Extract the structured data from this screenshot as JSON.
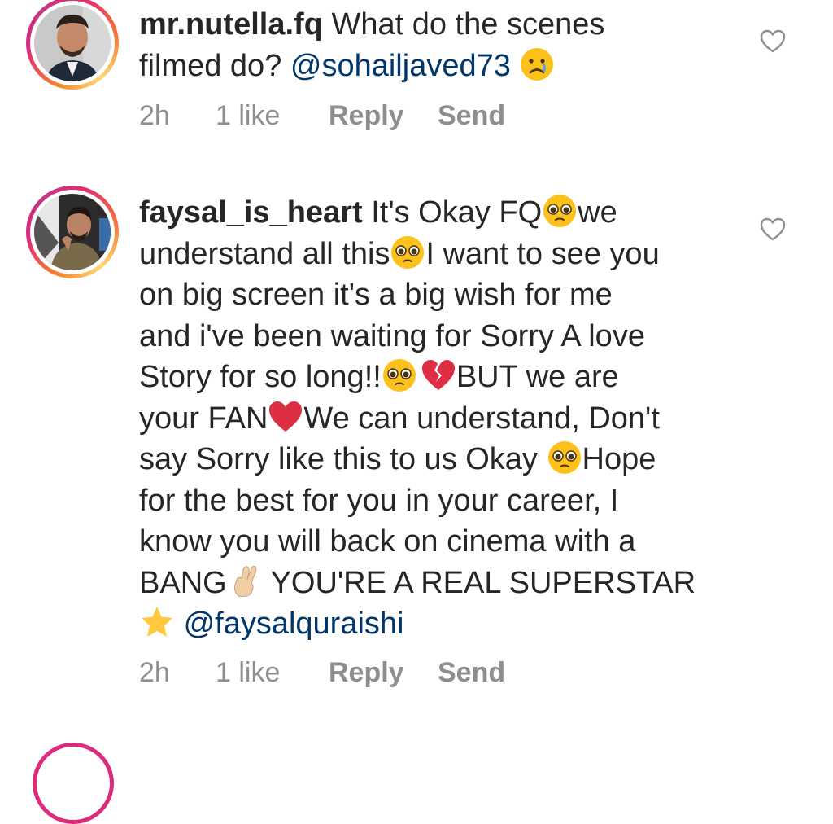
{
  "comments": [
    {
      "username": "mr.nutella.fq",
      "line1_text": "What do the scenes",
      "line2_text": "filmed do?",
      "mention": "@sohailjaved73",
      "emoji": "crying-face",
      "age": "2h",
      "likes": "1 like",
      "reply": "Reply",
      "send": "Send"
    },
    {
      "username": "faysal_is_heart",
      "l1": "It's Okay FQ",
      "l1b": "we",
      "l2a": "understand all this",
      "l2b": "I want to see you",
      "l3": "on big screen it's a big wish for me",
      "l4": "and i've been waiting for Sorry A love",
      "l5": "Story for so long!!",
      "l5b": "BUT we are",
      "l6a": "your FAN",
      "l6b": "We can understand, Don't",
      "l7a": "say Sorry like this to us Okay ",
      "l7b": "Hope",
      "l8": "for the best for you in your career, I",
      "l9": "know you will back on cinema with a",
      "l10a": "BANG",
      "l10b": " YOU'RE A REAL SUPERSTAR",
      "mention": "@faysalquraishi",
      "age": "2h",
      "likes": "1 like",
      "reply": "Reply",
      "send": "Send"
    }
  ],
  "colors": {
    "mention": "#00376b",
    "meta": "#8e8e8e",
    "text": "#262626"
  }
}
